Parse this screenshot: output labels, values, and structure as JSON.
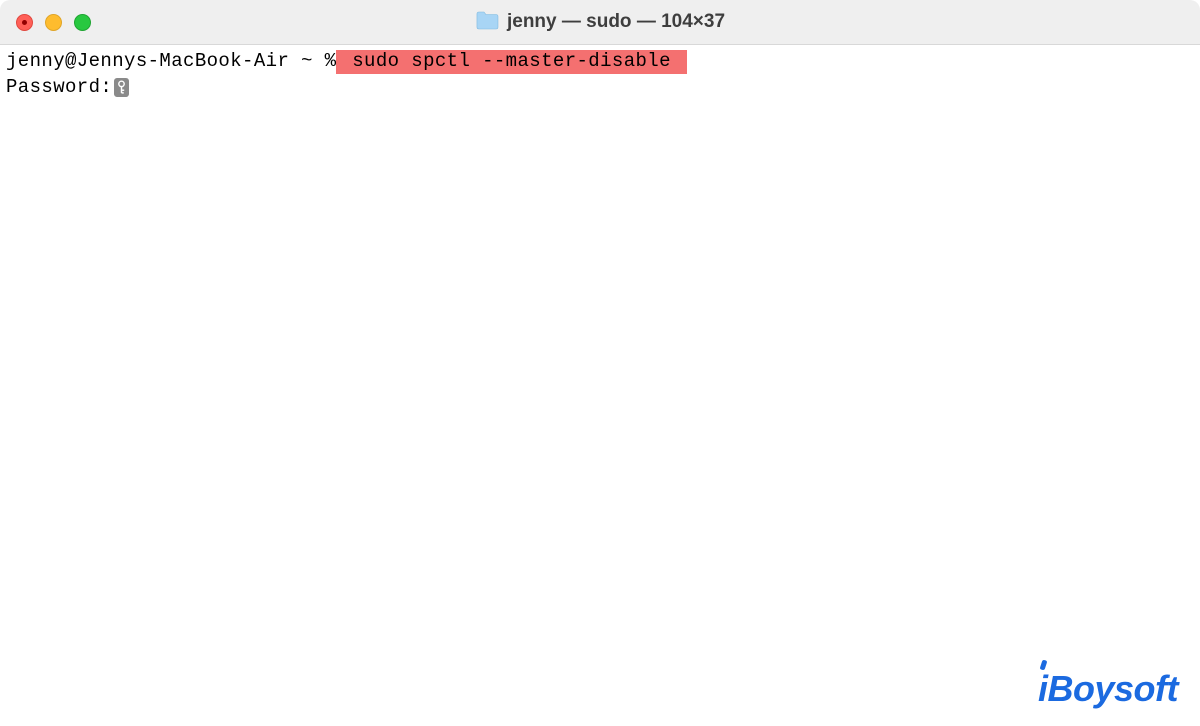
{
  "titlebar": {
    "title": "jenny — sudo — 104×37"
  },
  "terminal": {
    "prompt": "jenny@Jennys-MacBook-Air ~ %",
    "command": " sudo spctl --master-disable ",
    "password_label": "Password:"
  },
  "watermark": {
    "text_part1": "i",
    "text_part2": "Boysoft"
  },
  "colors": {
    "highlight_bg": "#f47070",
    "brand_blue": "#1b6ae0"
  }
}
